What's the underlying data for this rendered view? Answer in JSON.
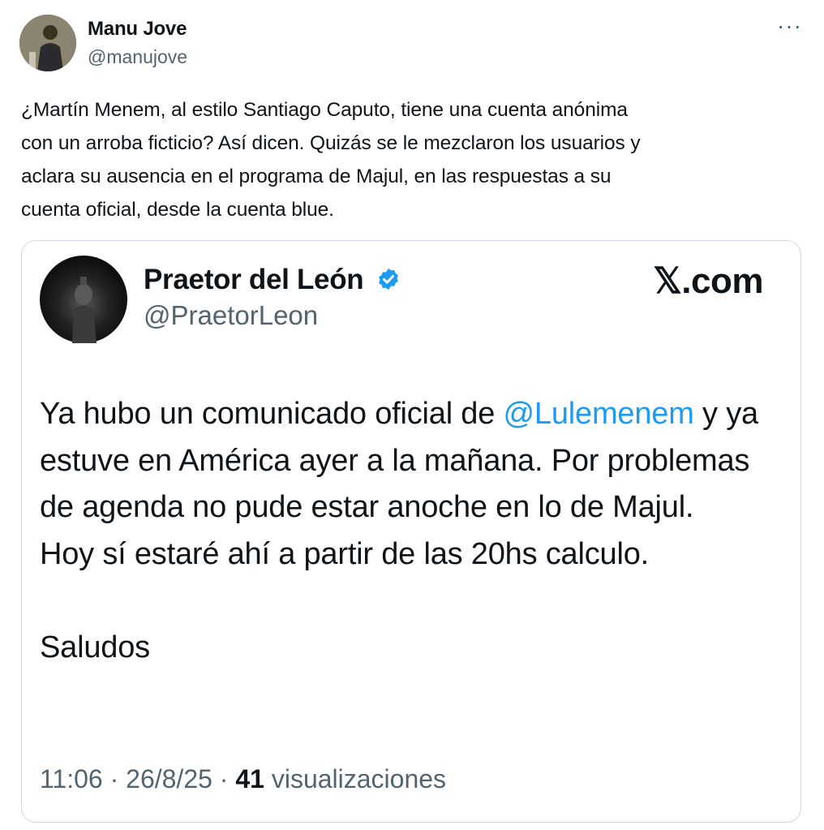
{
  "tweet": {
    "author_name": "Manu Jove",
    "author_handle": "@manujove",
    "more_label": "···",
    "text": "¿Martín Menem, al estilo Santiago Caputo, tiene una cuenta anónima\ncon un arroba ficticio? Así dicen. Quizás se le mezclaron los usuarios y\naclara su ausencia en el programa de Majul, en las respuestas a su\ncuenta oficial, desde la cuenta blue."
  },
  "quoted": {
    "author_name": "Praetor del León",
    "author_handle": "@PraetorLeon",
    "source_label": "𝕏.com",
    "text_before_mention": "Ya hubo un comunicado oficial de ",
    "mention": "@Lulemenem",
    "text_after_mention_1": "y ya estuve en América ayer a la mañana. Por problemas de agenda no pude estar anoche en lo de Majul.",
    "text_after_mention_2": "Hoy sí estaré ahí a partir de las 20hs calculo.",
    "text_closing": "Saludos",
    "time": "11:06",
    "separator": " · ",
    "date": "26/8/25",
    "views_count": "41",
    "views_label": "visualizaciones"
  },
  "colors": {
    "accent": "#1d9bf0",
    "secondary_text": "#536471",
    "border": "#cfd9de"
  }
}
